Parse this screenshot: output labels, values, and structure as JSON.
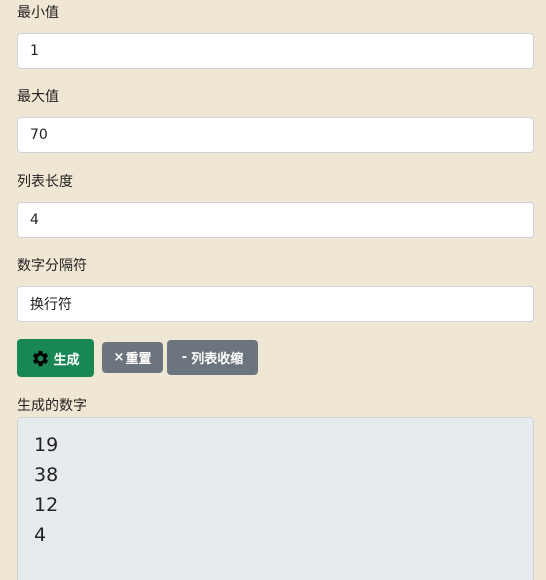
{
  "fields": {
    "min": {
      "label": "最小值",
      "value": "1"
    },
    "max": {
      "label": "最大值",
      "value": "70"
    },
    "length": {
      "label": "列表长度",
      "value": "4"
    },
    "separator": {
      "label": "数字分隔符",
      "value": "换行符"
    }
  },
  "buttons": {
    "generate": {
      "icon": "gear-icon",
      "label": "生成"
    },
    "reset": {
      "icon": "x-icon",
      "label": "重置",
      "prefix": "×"
    },
    "collapse": {
      "icon": "minus-icon",
      "label": "列表收缩",
      "prefix": "-"
    }
  },
  "output": {
    "label": "生成的数字",
    "numbers": [
      "19",
      "38",
      "12",
      "4"
    ]
  },
  "colors": {
    "background": "#efe6d3",
    "success": "#198754",
    "secondary": "#6c757d",
    "output_bg": "#e8ebee"
  }
}
